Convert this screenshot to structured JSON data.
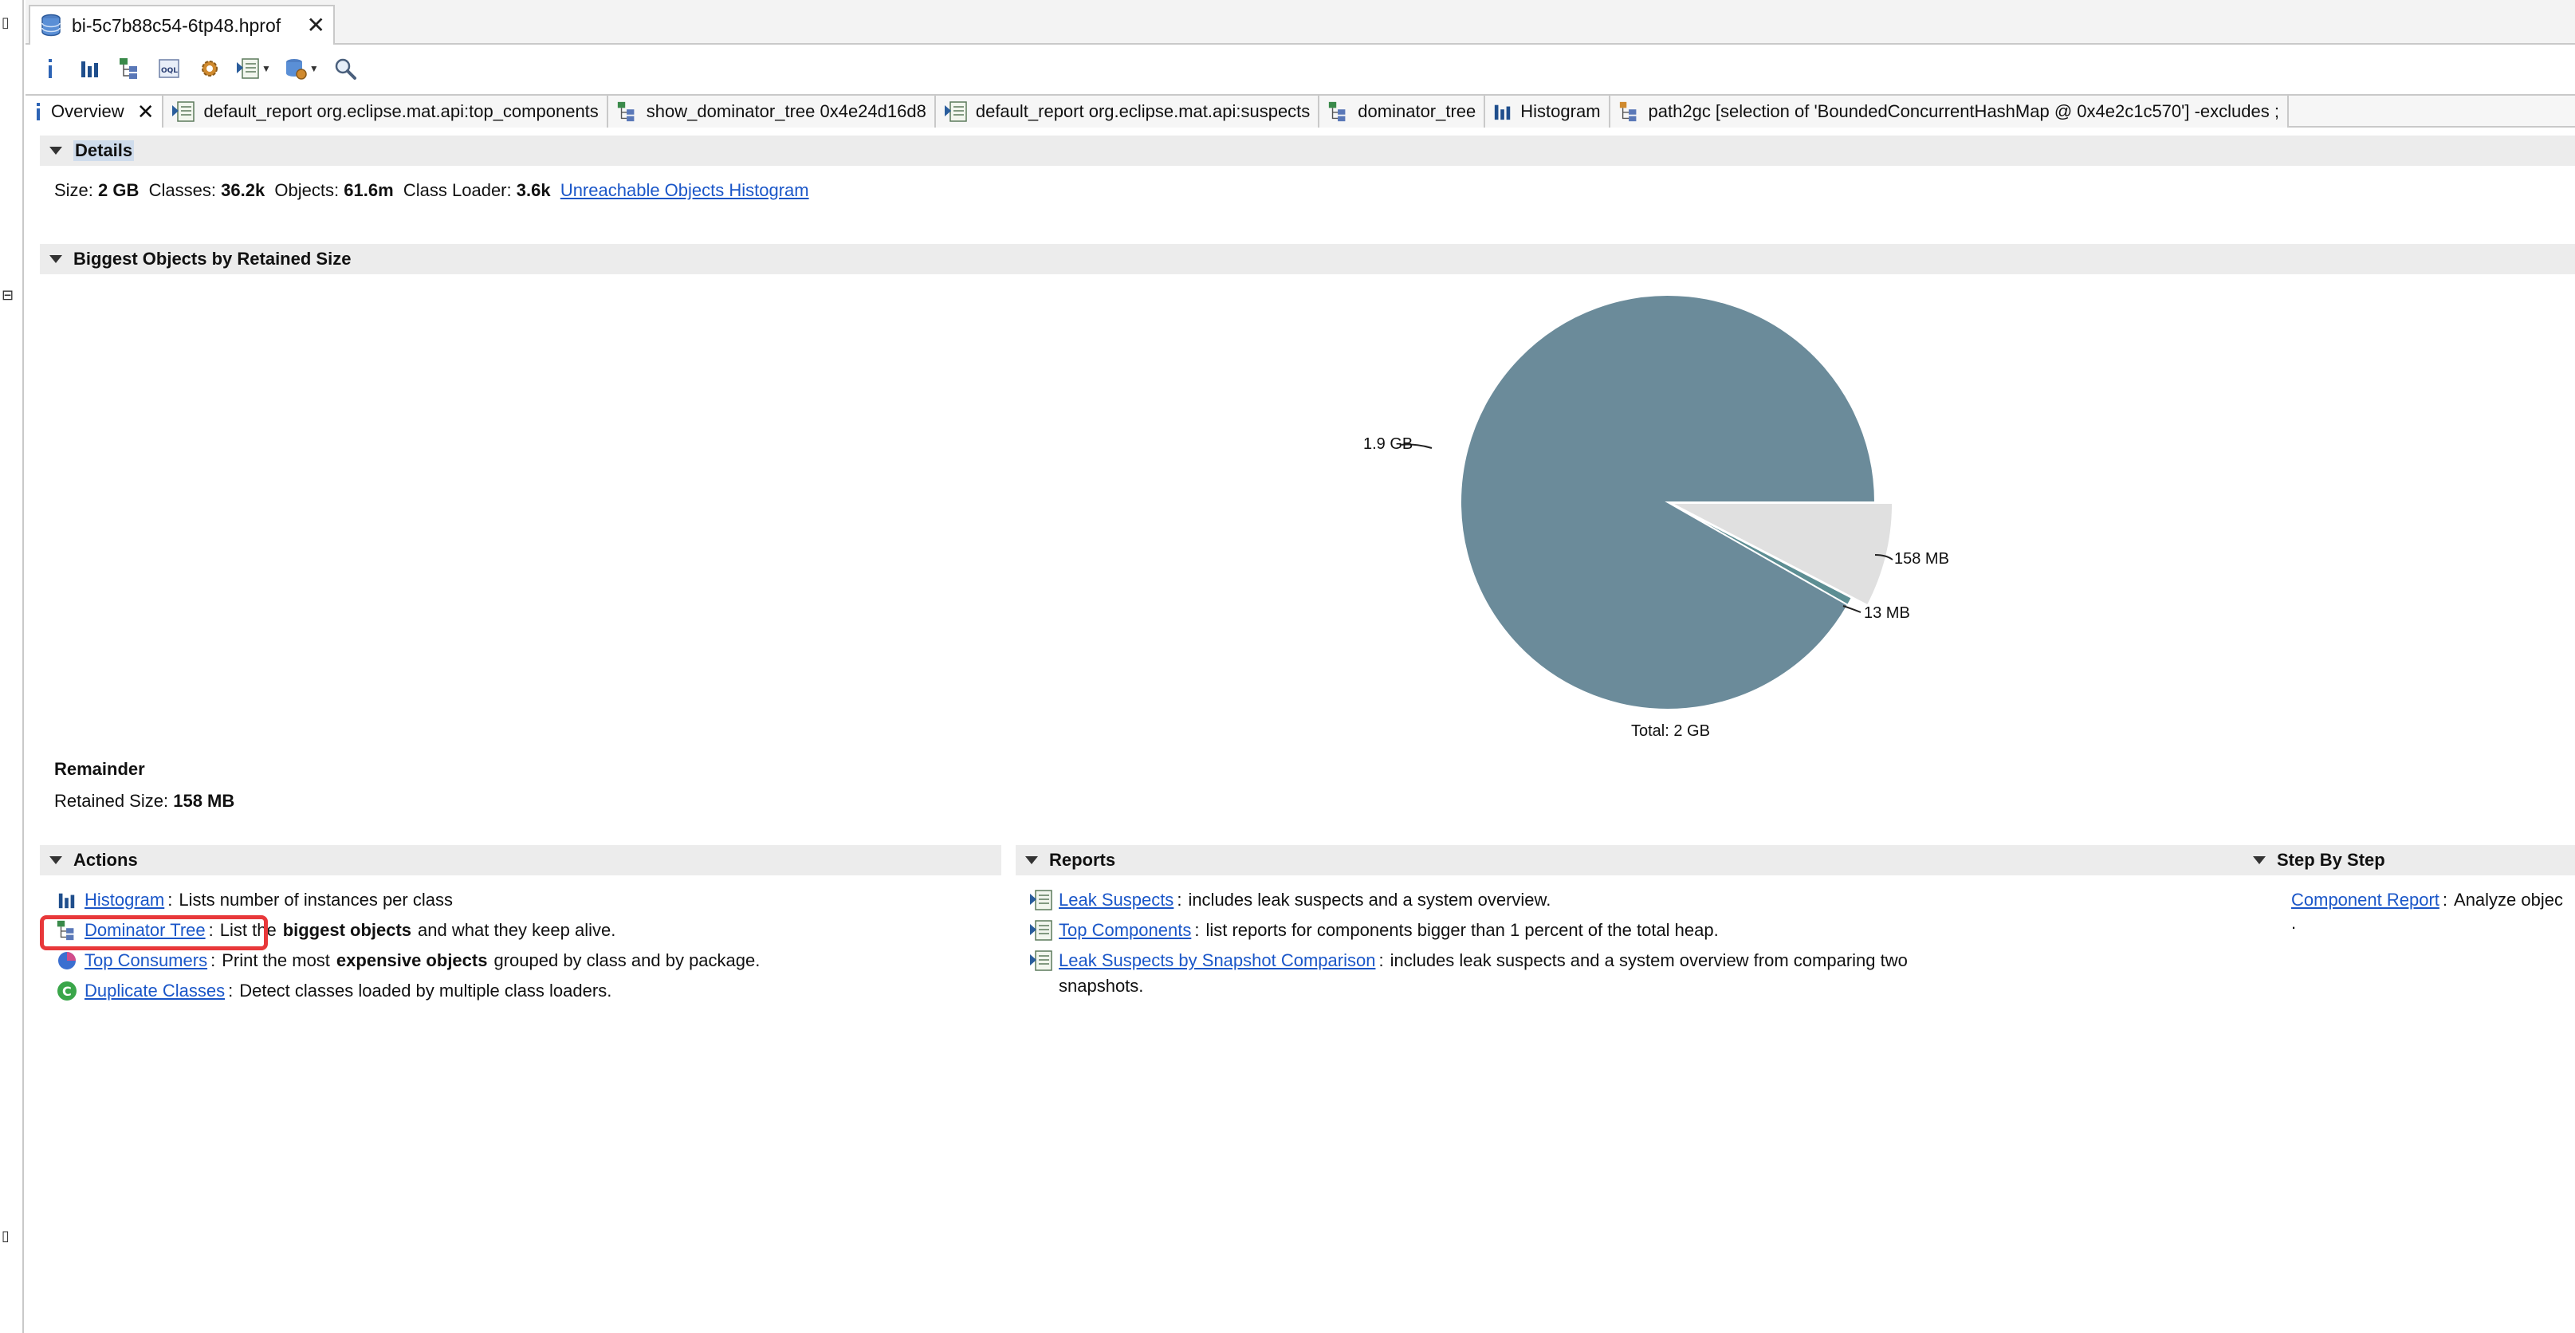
{
  "editor_tab": {
    "label": "bi-5c7b88c54-6tp48.hprof"
  },
  "toolbar": {
    "buttons": [
      "info-icon",
      "histogram-icon",
      "dominator-tree-icon",
      "oql-icon",
      "gear-icon",
      "report-dropdown-icon",
      "query-dropdown-icon",
      "search-icon"
    ]
  },
  "subtabs": [
    {
      "label": "Overview",
      "closable": true,
      "icon": "info-icon"
    },
    {
      "label": "default_report org.eclipse.mat.api:top_components",
      "icon": "report-icon"
    },
    {
      "label": "show_dominator_tree 0x4e24d16d8",
      "icon": "dominator-tree-icon"
    },
    {
      "label": "default_report org.eclipse.mat.api:suspects",
      "icon": "report-icon"
    },
    {
      "label": "dominator_tree",
      "icon": "dominator-tree-icon"
    },
    {
      "label": "Histogram",
      "icon": "histogram-icon"
    },
    {
      "label": "path2gc [selection of 'BoundedConcurrentHashMap @ 0x4e2c1c570'] -excludes ;",
      "icon": "path-icon"
    }
  ],
  "details": {
    "title": "Details",
    "size_label": "Size:",
    "size_value": "2 GB",
    "classes_label": "Classes:",
    "classes_value": "36.2k",
    "objects_label": "Objects:",
    "objects_value": "61.6m",
    "loader_label": "Class Loader:",
    "loader_value": "3.6k",
    "unreachable_link": "Unreachable Objects Histogram"
  },
  "biggest": {
    "title": "Biggest Objects by Retained Size",
    "total_label": "Total: 2 GB"
  },
  "chart_data": {
    "type": "pie",
    "slices": [
      {
        "label": "1.9 GB",
        "value": 1.9,
        "unit": "GB",
        "color": "#6b8b9a"
      },
      {
        "label": "13 MB",
        "value": 0.013,
        "unit": "GB",
        "color": "#5d8e93"
      },
      {
        "label": "158 MB",
        "value": 0.158,
        "unit": "GB",
        "color": "#e0e0e0"
      }
    ],
    "title": "",
    "total": "Total: 2 GB"
  },
  "remainder": {
    "title": "Remainder",
    "retained_label": "Retained Size:",
    "retained_value": "158 MB"
  },
  "actions": {
    "title": "Actions",
    "items": [
      {
        "link": "Histogram",
        "text": "Lists number of instances per class",
        "icon": "histogram-icon"
      },
      {
        "link": "Dominator Tree",
        "pre": "List the",
        "bold": "biggest objects",
        "post": "and what they keep alive.",
        "icon": "dominator-tree-icon"
      },
      {
        "link": "Top Consumers",
        "pre": "Print the most",
        "bold": "expensive objects",
        "post": "grouped by class and by package.",
        "icon": "pie-icon"
      },
      {
        "link": "Duplicate Classes",
        "text": "Detect classes loaded by multiple class loaders.",
        "icon": "duplicate-classes-icon"
      }
    ]
  },
  "reports": {
    "title": "Reports",
    "items": [
      {
        "link": "Leak Suspects",
        "text": "includes leak suspects and a system overview."
      },
      {
        "link": "Top Components",
        "text": "list reports for components bigger than 1 percent of the total heap."
      },
      {
        "link": "Leak Suspects by Snapshot Comparison",
        "text": "includes leak suspects and a system overview from comparing two",
        "text2": "snapshots."
      }
    ]
  },
  "stepbystep": {
    "title": "Step By Step",
    "link": "Component Report",
    "text": "Analyze objec",
    "text2": "."
  },
  "colors": {
    "link": "#1a56c8",
    "highlight": "#e8383a",
    "section_bg": "#ececec"
  }
}
